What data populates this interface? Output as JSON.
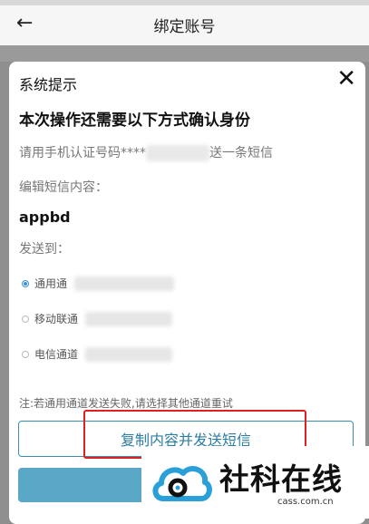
{
  "nav": {
    "back_icon": "back-arrow-icon",
    "title": "绑定账号"
  },
  "modal": {
    "title": "系统提示",
    "close_icon": "close-icon",
    "headline": "本次操作还需要以下方式确认身份",
    "hint_prefix": "请用手机认证号码****",
    "hint_suffix": "送一条短信",
    "edit_label": "编辑短信内容：",
    "sms_content": "appbd",
    "send_to_label": "发送到：",
    "options": [
      {
        "label": "通用通",
        "selected": true
      },
      {
        "label": "移动联通",
        "selected": false
      },
      {
        "label": "电信通道",
        "selected": false
      }
    ],
    "note": "注:若通用通道发送失败,请选择其他通道重试",
    "copy_send_button": "复制内容并发送短信"
  },
  "watermark": {
    "title": "社科在线",
    "url": "cass.com.cn"
  },
  "colors": {
    "accent": "#3a8fb0",
    "highlight": "#e02020",
    "primary_fill": "#5aa7c7"
  }
}
